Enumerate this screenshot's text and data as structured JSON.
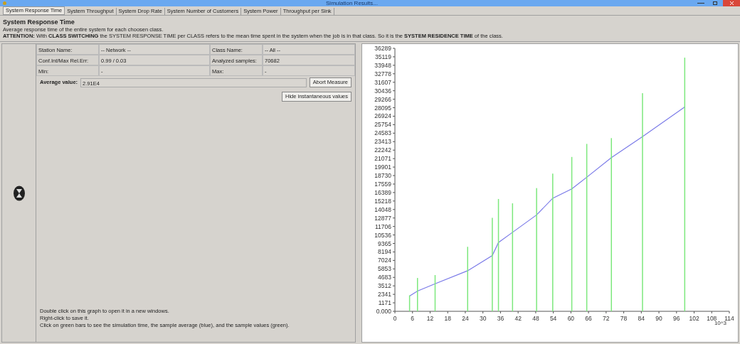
{
  "window": {
    "title": "Simulation Results..."
  },
  "tabs": [
    {
      "label": "System Response Time",
      "selected": true
    },
    {
      "label": "System Throughput",
      "selected": false
    },
    {
      "label": "System Drop Rate",
      "selected": false
    },
    {
      "label": "System Number of Customers",
      "selected": false
    },
    {
      "label": "System Power",
      "selected": false
    },
    {
      "label": "Throughput per Sink",
      "selected": false
    }
  ],
  "header": {
    "title": "System Response Time",
    "description": "Average response time of the entire system for each choosen class.",
    "attention": "**ATTENTION:** With **CLASS SWITCHING** the SYSTEM RESPONSE TIME per CLASS refers to the mean time spent in the system when the job is in that class. So it is the **SYSTEM RESIDENCE TIME** of the class."
  },
  "fields": [
    {
      "label": "Station Name:",
      "value": "-- Network --"
    },
    {
      "label": "Class Name:",
      "value": "-- All --"
    },
    {
      "label": "Conf.Int/Max Rel.Err:",
      "value": "0.99 / 0.03"
    },
    {
      "label": "Analyzed samples:",
      "value": "70682"
    },
    {
      "label": "Min:",
      "value": "-"
    },
    {
      "label": "Max:",
      "value": "-"
    }
  ],
  "average": {
    "label": "Average value:",
    "value": "2.91E4"
  },
  "buttons": {
    "abort": "Abort Measure",
    "hide": "Hide instantaneous values"
  },
  "help": [
    "Double click on this graph to open it in a new windows.",
    "Right-click to save it.",
    "Click on green bars to see the simulation time, the sample average (blue), and the sample values (green)."
  ],
  "chart": {
    "x_unit": "10^3",
    "chart_data": {
      "type": "line",
      "xlim": [
        0,
        114
      ],
      "ylim": [
        0,
        36289
      ],
      "xticks": [
        0,
        6,
        12,
        18,
        24,
        30,
        36,
        42,
        48,
        54,
        60,
        66,
        72,
        78,
        84,
        90,
        96,
        102,
        108,
        114
      ],
      "yticks": [
        {
          "value": 0,
          "label": "0.000"
        },
        1171,
        2341,
        3512,
        4683,
        5853,
        7024,
        8194,
        9365,
        10536,
        11706,
        12877,
        14048,
        15218,
        16389,
        17559,
        18730,
        19901,
        21071,
        22242,
        23413,
        24583,
        25754,
        26924,
        28095,
        29266,
        30436,
        31607,
        32778,
        33948,
        35119,
        36289
      ],
      "x": [
        5.0,
        7.7,
        13.7,
        24.8,
        33.2,
        35.3,
        40.1,
        48.3,
        53.8,
        60.3,
        65.4,
        73.8,
        84.4,
        98.8
      ],
      "series": [
        {
          "type": "line",
          "color": "#7b7be8",
          "values": [
            2100,
            2800,
            3800,
            5600,
            7700,
            9500,
            10900,
            13300,
            15600,
            16900,
            18500,
            21200,
            24100,
            28200
          ]
        },
        {
          "type": "bar",
          "color": "#7de87d",
          "values": [
            2200,
            4600,
            5000,
            8900,
            12900,
            15500,
            14900,
            17000,
            19000,
            21300,
            23100,
            23900,
            30100,
            35000
          ]
        }
      ]
    }
  }
}
